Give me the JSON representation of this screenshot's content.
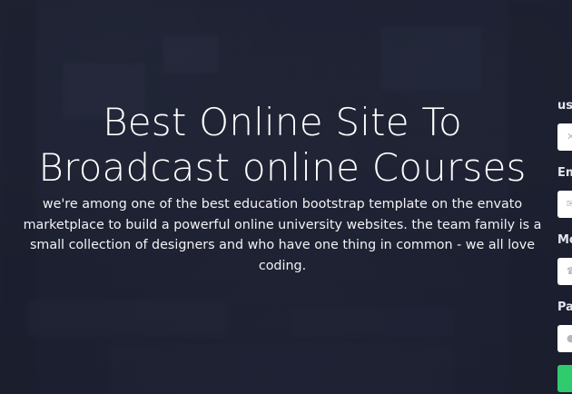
{
  "hero": {
    "title_line1": "Best Online Site To",
    "title_line2": "Broadcast online Courses",
    "description": "we're among one of the best education bootstrap template on the envato marketplace to build a powerful online university websites. the team family is a small collection of designers and who have one thing in common - we all love coding."
  },
  "form": {
    "fields": [
      {
        "label": "us",
        "icon": "user-icon"
      },
      {
        "label": "Em",
        "icon": "mail-icon"
      },
      {
        "label": "Mo",
        "icon": "phone-icon"
      },
      {
        "label": "Pa",
        "icon": "lock-icon"
      }
    ],
    "submit_color": "#2fcb6d"
  },
  "colors": {
    "overlay": "#232739",
    "text": "#ffffff",
    "accent": "#2fcb6d"
  }
}
